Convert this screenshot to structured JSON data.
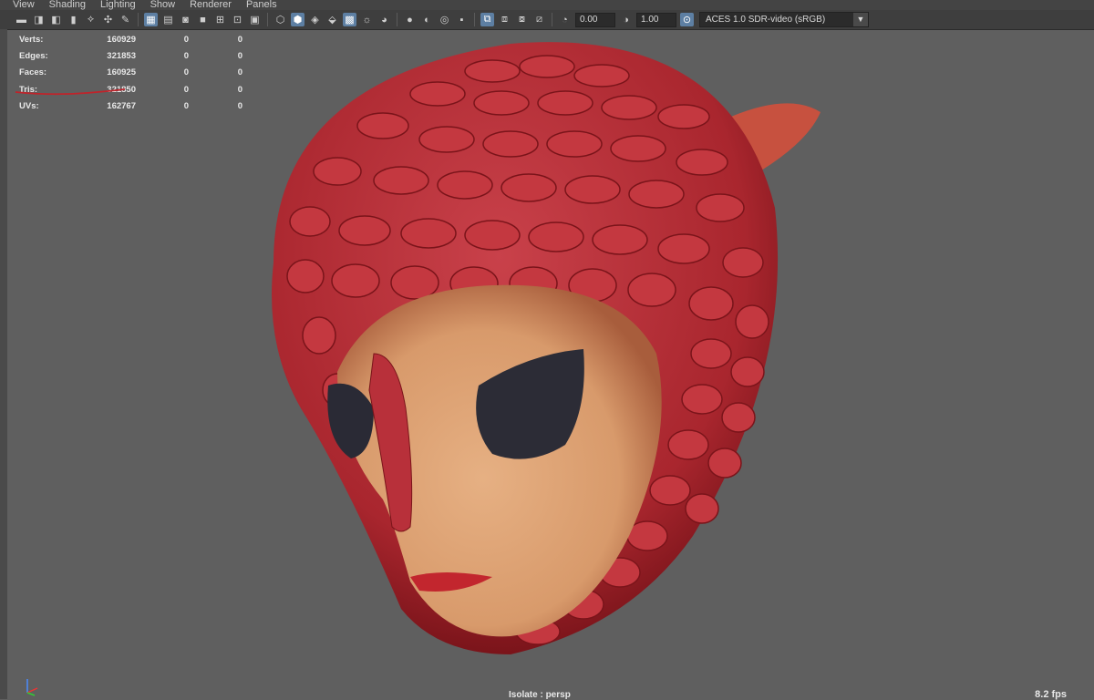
{
  "menu": [
    "View",
    "Shading",
    "Lighting",
    "Show",
    "Renderer",
    "Panels"
  ],
  "toolbar": {
    "exposure": "0.00",
    "gamma": "1.00",
    "color_space": "ACES 1.0 SDR-video (sRGB)",
    "accent": "#5d7fa3"
  },
  "hud": {
    "rows": [
      {
        "label": "Verts:",
        "v1": "160929",
        "v2": "0",
        "v3": "0"
      },
      {
        "label": "Edges:",
        "v1": "321853",
        "v2": "0",
        "v3": "0"
      },
      {
        "label": "Faces:",
        "v1": "160925",
        "v2": "0",
        "v3": "0"
      },
      {
        "label": "Tris:",
        "v1": "321850",
        "v2": "0",
        "v3": "0"
      },
      {
        "label": "UVs:",
        "v1": "162767",
        "v2": "0",
        "v3": "0"
      }
    ]
  },
  "status": {
    "isolate": "Isolate : persp",
    "fps": "8.2 fps"
  }
}
